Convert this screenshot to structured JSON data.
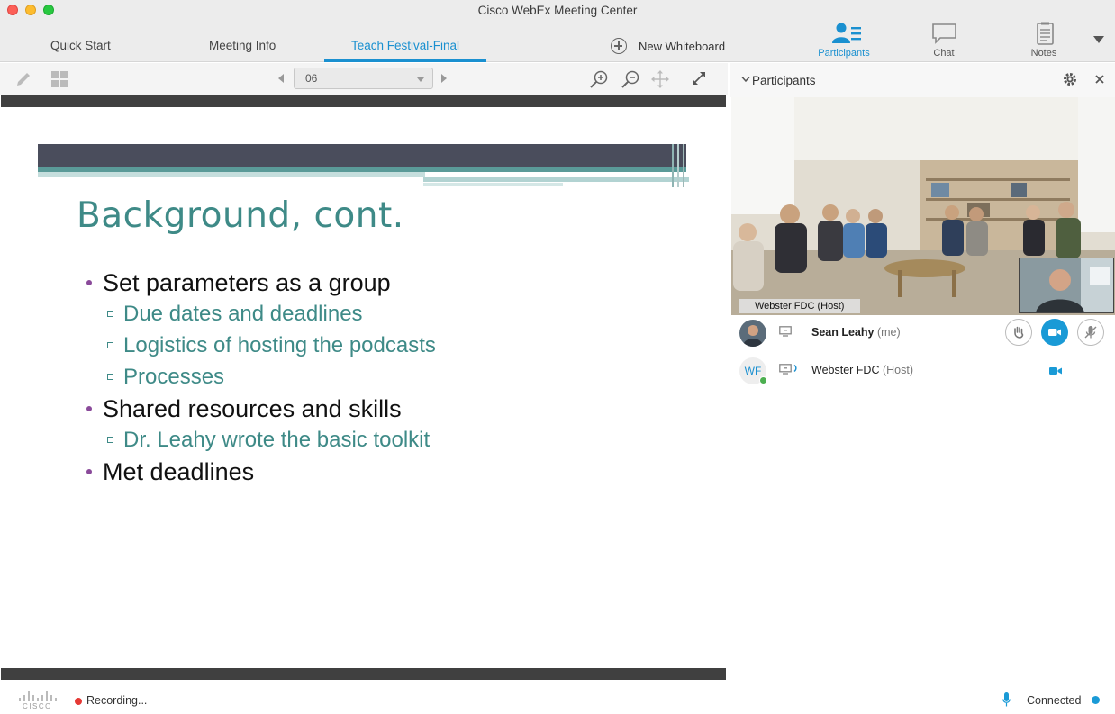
{
  "window": {
    "title": "Cisco WebEx Meeting Center"
  },
  "tabs": [
    {
      "label": "Quick Start"
    },
    {
      "label": "Meeting Info"
    },
    {
      "label": "Teach Festival-Final",
      "active": true
    }
  ],
  "new_whiteboard": {
    "label": "New Whiteboard"
  },
  "right_toolbar": {
    "participants_label": "Participants",
    "chat_label": "Chat",
    "notes_label": "Notes"
  },
  "slide_toolbar": {
    "page_value": "06"
  },
  "slide": {
    "title": "Background, cont.",
    "bullets": [
      {
        "level": 1,
        "text": "Set parameters as a group"
      },
      {
        "level": 2,
        "text": "Due dates and deadlines"
      },
      {
        "level": 2,
        "text": "Logistics of hosting the podcasts"
      },
      {
        "level": 2,
        "text": "Processes"
      },
      {
        "level": 1,
        "text": "Shared resources and skills"
      },
      {
        "level": 2,
        "text": "Dr. Leahy wrote the basic toolkit"
      },
      {
        "level": 1,
        "text": "Met deadlines"
      }
    ]
  },
  "participants_panel": {
    "title": "Participants",
    "video_label": "Webster FDC (Host)",
    "participants": [
      {
        "name": "Sean Leahy",
        "tag": "(me)",
        "avatar": "photo"
      },
      {
        "name": "Webster FDC",
        "tag": "(Host)",
        "initials": "WF"
      }
    ]
  },
  "status": {
    "recording": "Recording...",
    "connection": "Connected",
    "brand": "CISCO"
  },
  "colors": {
    "accent": "#1a90d0",
    "slide_title": "#3e8a87",
    "recording": "#e53935"
  }
}
